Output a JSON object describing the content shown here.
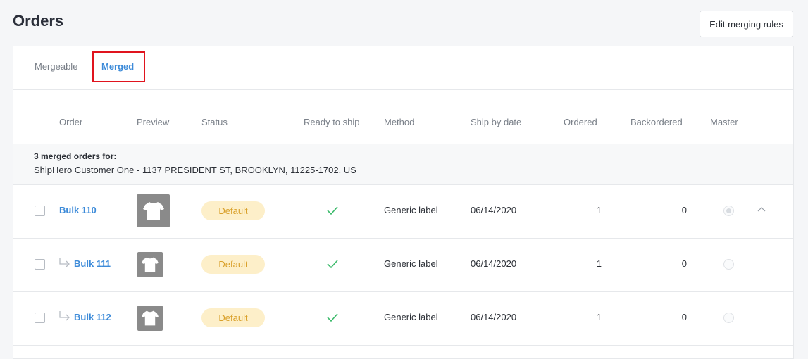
{
  "page": {
    "title": "Orders"
  },
  "toolbar": {
    "edit_merging_rules": "Edit merging rules"
  },
  "tabs": [
    {
      "label": "Mergeable",
      "active": false
    },
    {
      "label": "Merged",
      "active": true
    }
  ],
  "columns": [
    "Order",
    "Preview",
    "Status",
    "Ready to ship",
    "Method",
    "Ship by date",
    "Ordered",
    "Backordered",
    "Master"
  ],
  "group": {
    "title": "3 merged orders for:",
    "address": "ShipHero Customer One - 1137 PRESIDENT ST, BROOKLYN, 11225-1702. US"
  },
  "rows": [
    {
      "order": "Bulk 110",
      "status": "Default",
      "ready": true,
      "method": "Generic label",
      "ship_by": "06/14/2020",
      "ordered": "1",
      "backordered": "0",
      "master": true,
      "child": false
    },
    {
      "order": "Bulk 111",
      "status": "Default",
      "ready": true,
      "method": "Generic label",
      "ship_by": "06/14/2020",
      "ordered": "1",
      "backordered": "0",
      "master": false,
      "child": true
    },
    {
      "order": "Bulk 112",
      "status": "Default",
      "ready": true,
      "method": "Generic label",
      "ship_by": "06/14/2020",
      "ordered": "1",
      "backordered": "0",
      "master": false,
      "child": true
    }
  ],
  "colors": {
    "accent": "#3d8bd9",
    "badge_bg": "#fdefc9",
    "badge_text": "#d9a02a",
    "check": "#3cba6b",
    "highlight": "#e0141e"
  },
  "icons": {
    "ready": "check-icon",
    "child": "sub-arrow-icon",
    "collapse": "chevron-up-icon"
  }
}
